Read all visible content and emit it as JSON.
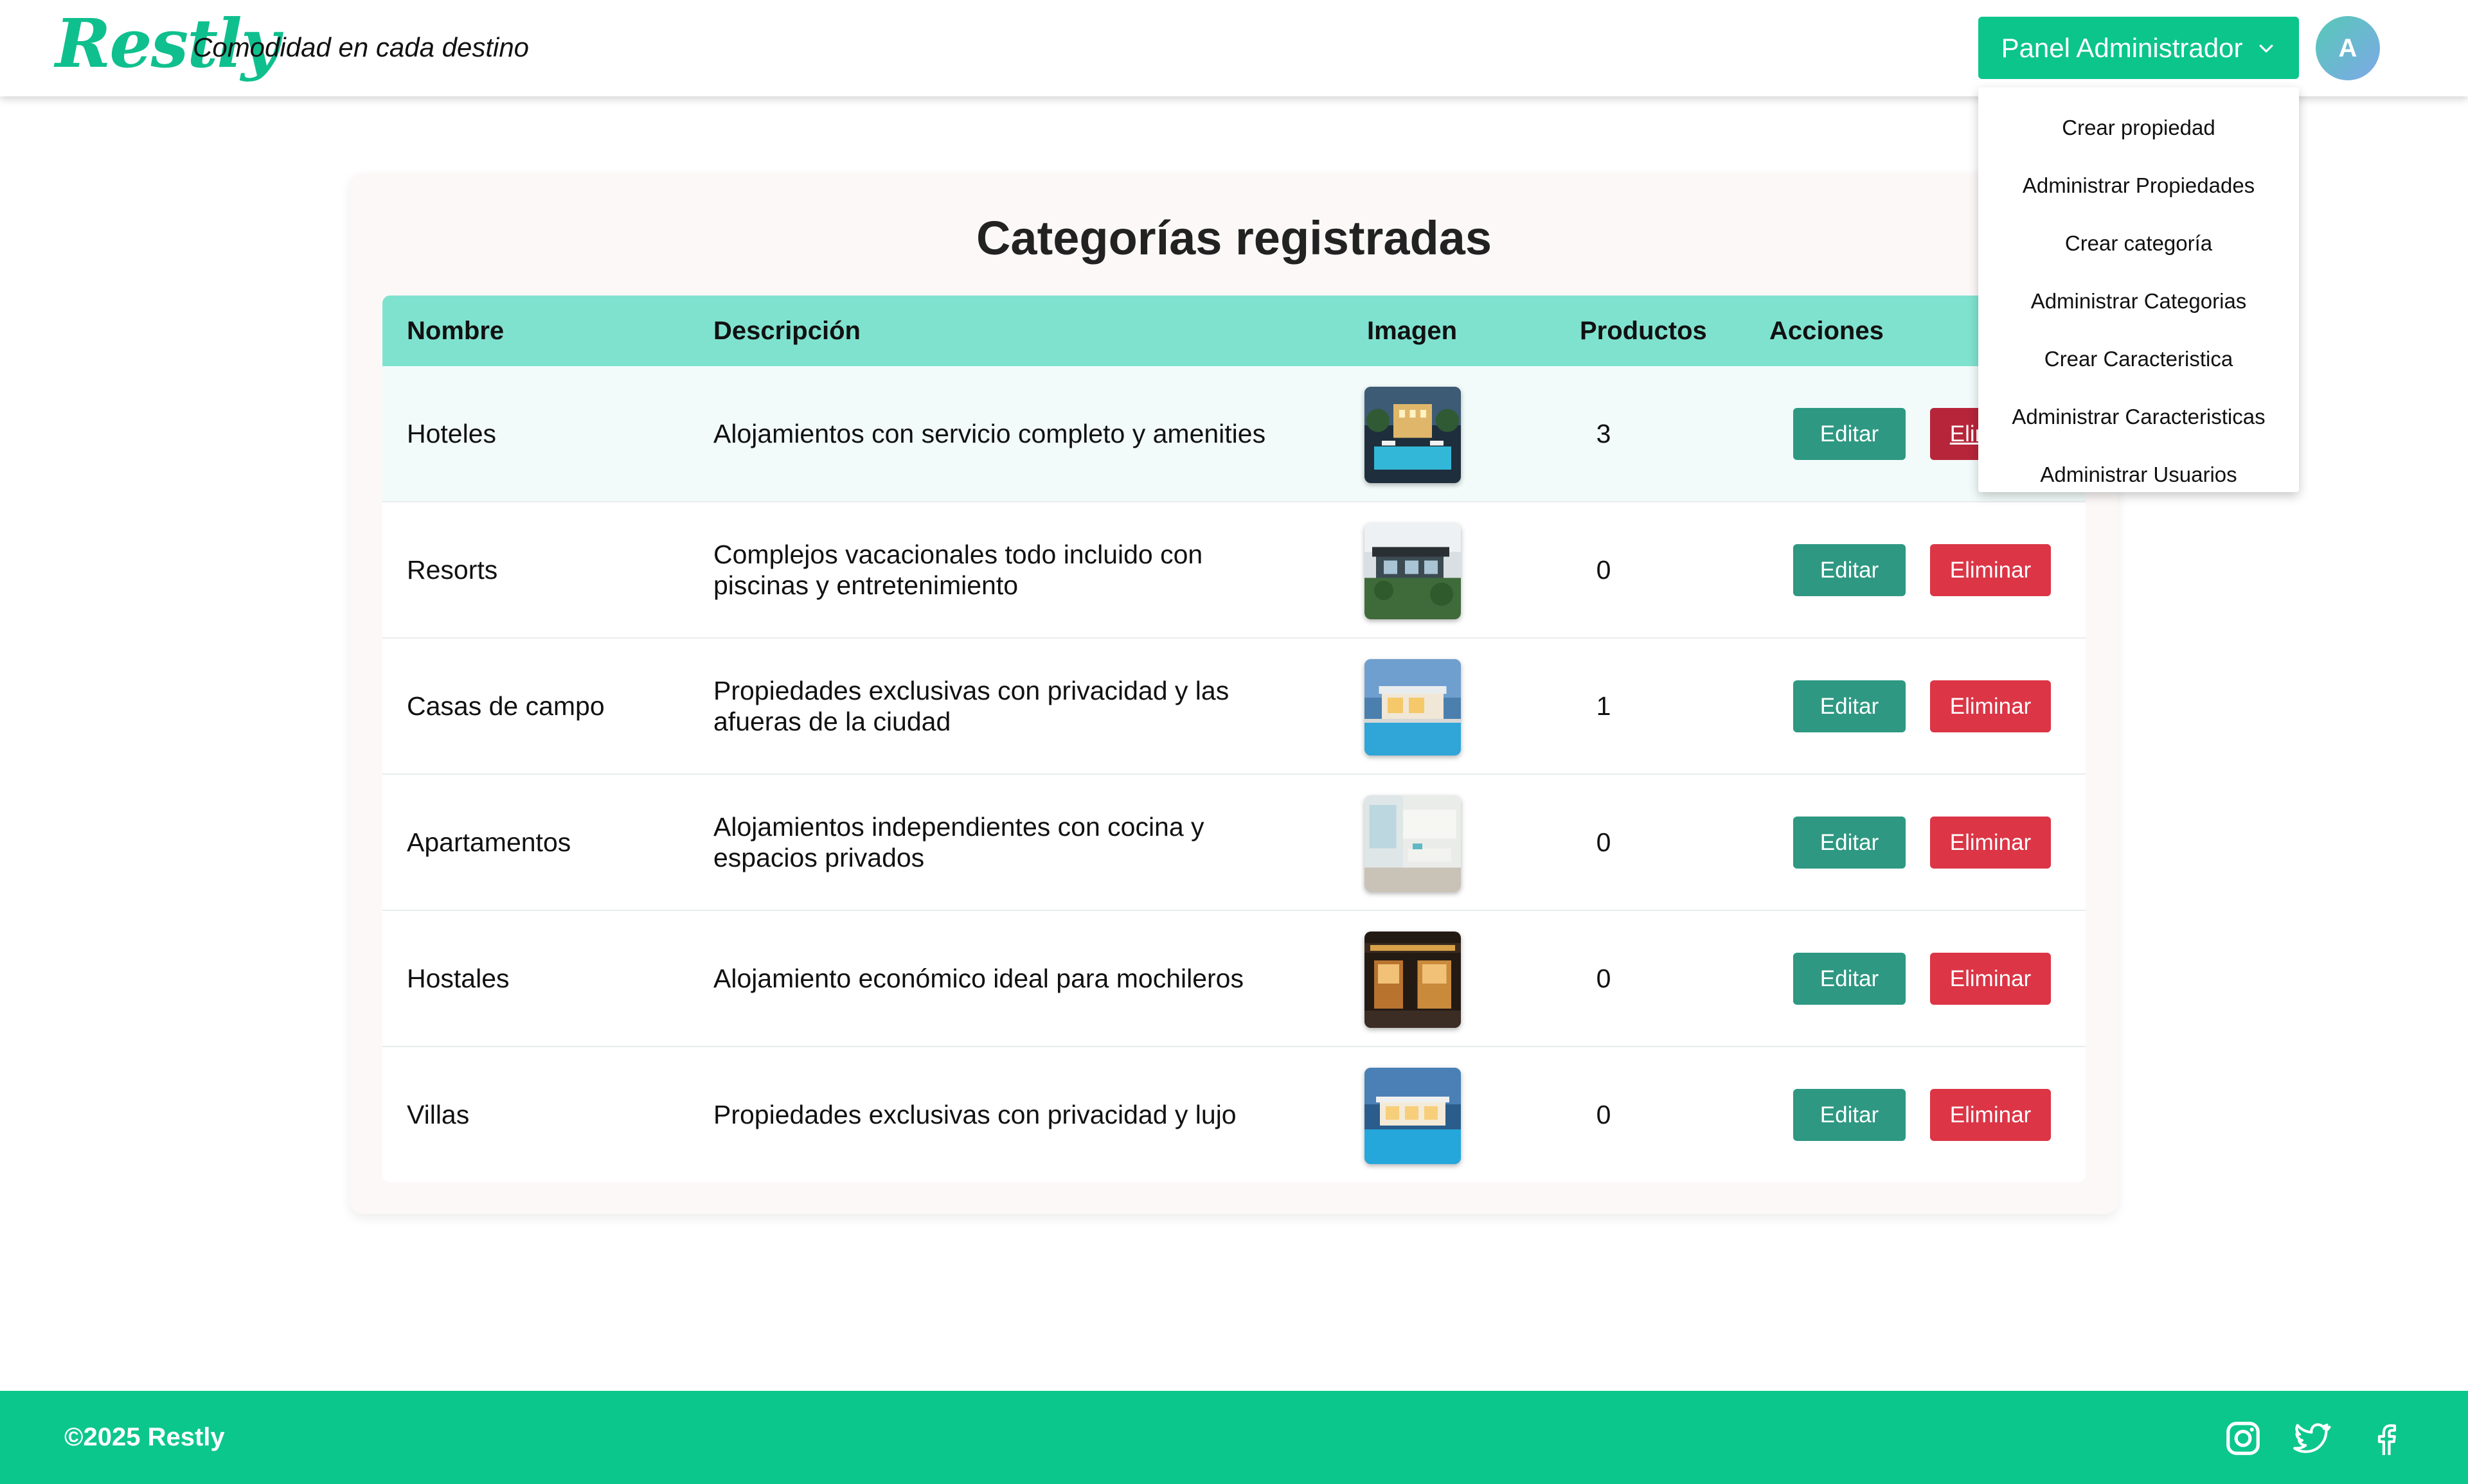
{
  "header": {
    "logo": "Restly",
    "tagline": "Comodidad en cada destino",
    "panel_button": "Panel Administrador",
    "avatar_initial": "A"
  },
  "dropdown": {
    "items": [
      "Crear propiedad",
      "Administrar Propiedades",
      "Crear categoría",
      "Administrar Categorias",
      "Crear Caracteristica",
      "Administrar Caracteristicas",
      "Administrar Usuarios"
    ]
  },
  "main": {
    "title": "Categorías registradas",
    "columns": [
      "Nombre",
      "Descripción",
      "Imagen",
      "Productos",
      "Acciones"
    ],
    "edit_label": "Editar",
    "delete_label": "Eliminar",
    "rows": [
      {
        "name": "Hoteles",
        "description": "Alojamientos con servicio completo y amenities",
        "products": "3",
        "image": "hotel-pool-night"
      },
      {
        "name": "Resorts",
        "description": "Complejos vacacionales todo incluido con piscinas y entretenimiento",
        "products": "0",
        "image": "modern-resort-garden"
      },
      {
        "name": "Casas de campo",
        "description": "Propiedades exclusivas con privacidad y las afueras de la ciudad",
        "products": "1",
        "image": "house-pool-dusk"
      },
      {
        "name": "Apartamentos",
        "description": "Alojamientos independientes con cocina y espacios privados",
        "products": "0",
        "image": "bright-living-room"
      },
      {
        "name": "Hostales",
        "description": "Alojamiento económico ideal para mochileros",
        "products": "0",
        "image": "hostel-facade-night"
      },
      {
        "name": "Villas",
        "description": "Propiedades exclusivas con privacidad y lujo",
        "products": "0",
        "image": "villa-pool-twilight"
      }
    ]
  },
  "footer": {
    "copyright": "©2025 Restly",
    "social": [
      "instagram-icon",
      "twitter-icon",
      "facebook-icon"
    ]
  },
  "colors": {
    "brand": "#0bc78b",
    "table_header": "#7fe2cf",
    "edit_button": "#2e9882",
    "delete_button": "#db3546"
  }
}
